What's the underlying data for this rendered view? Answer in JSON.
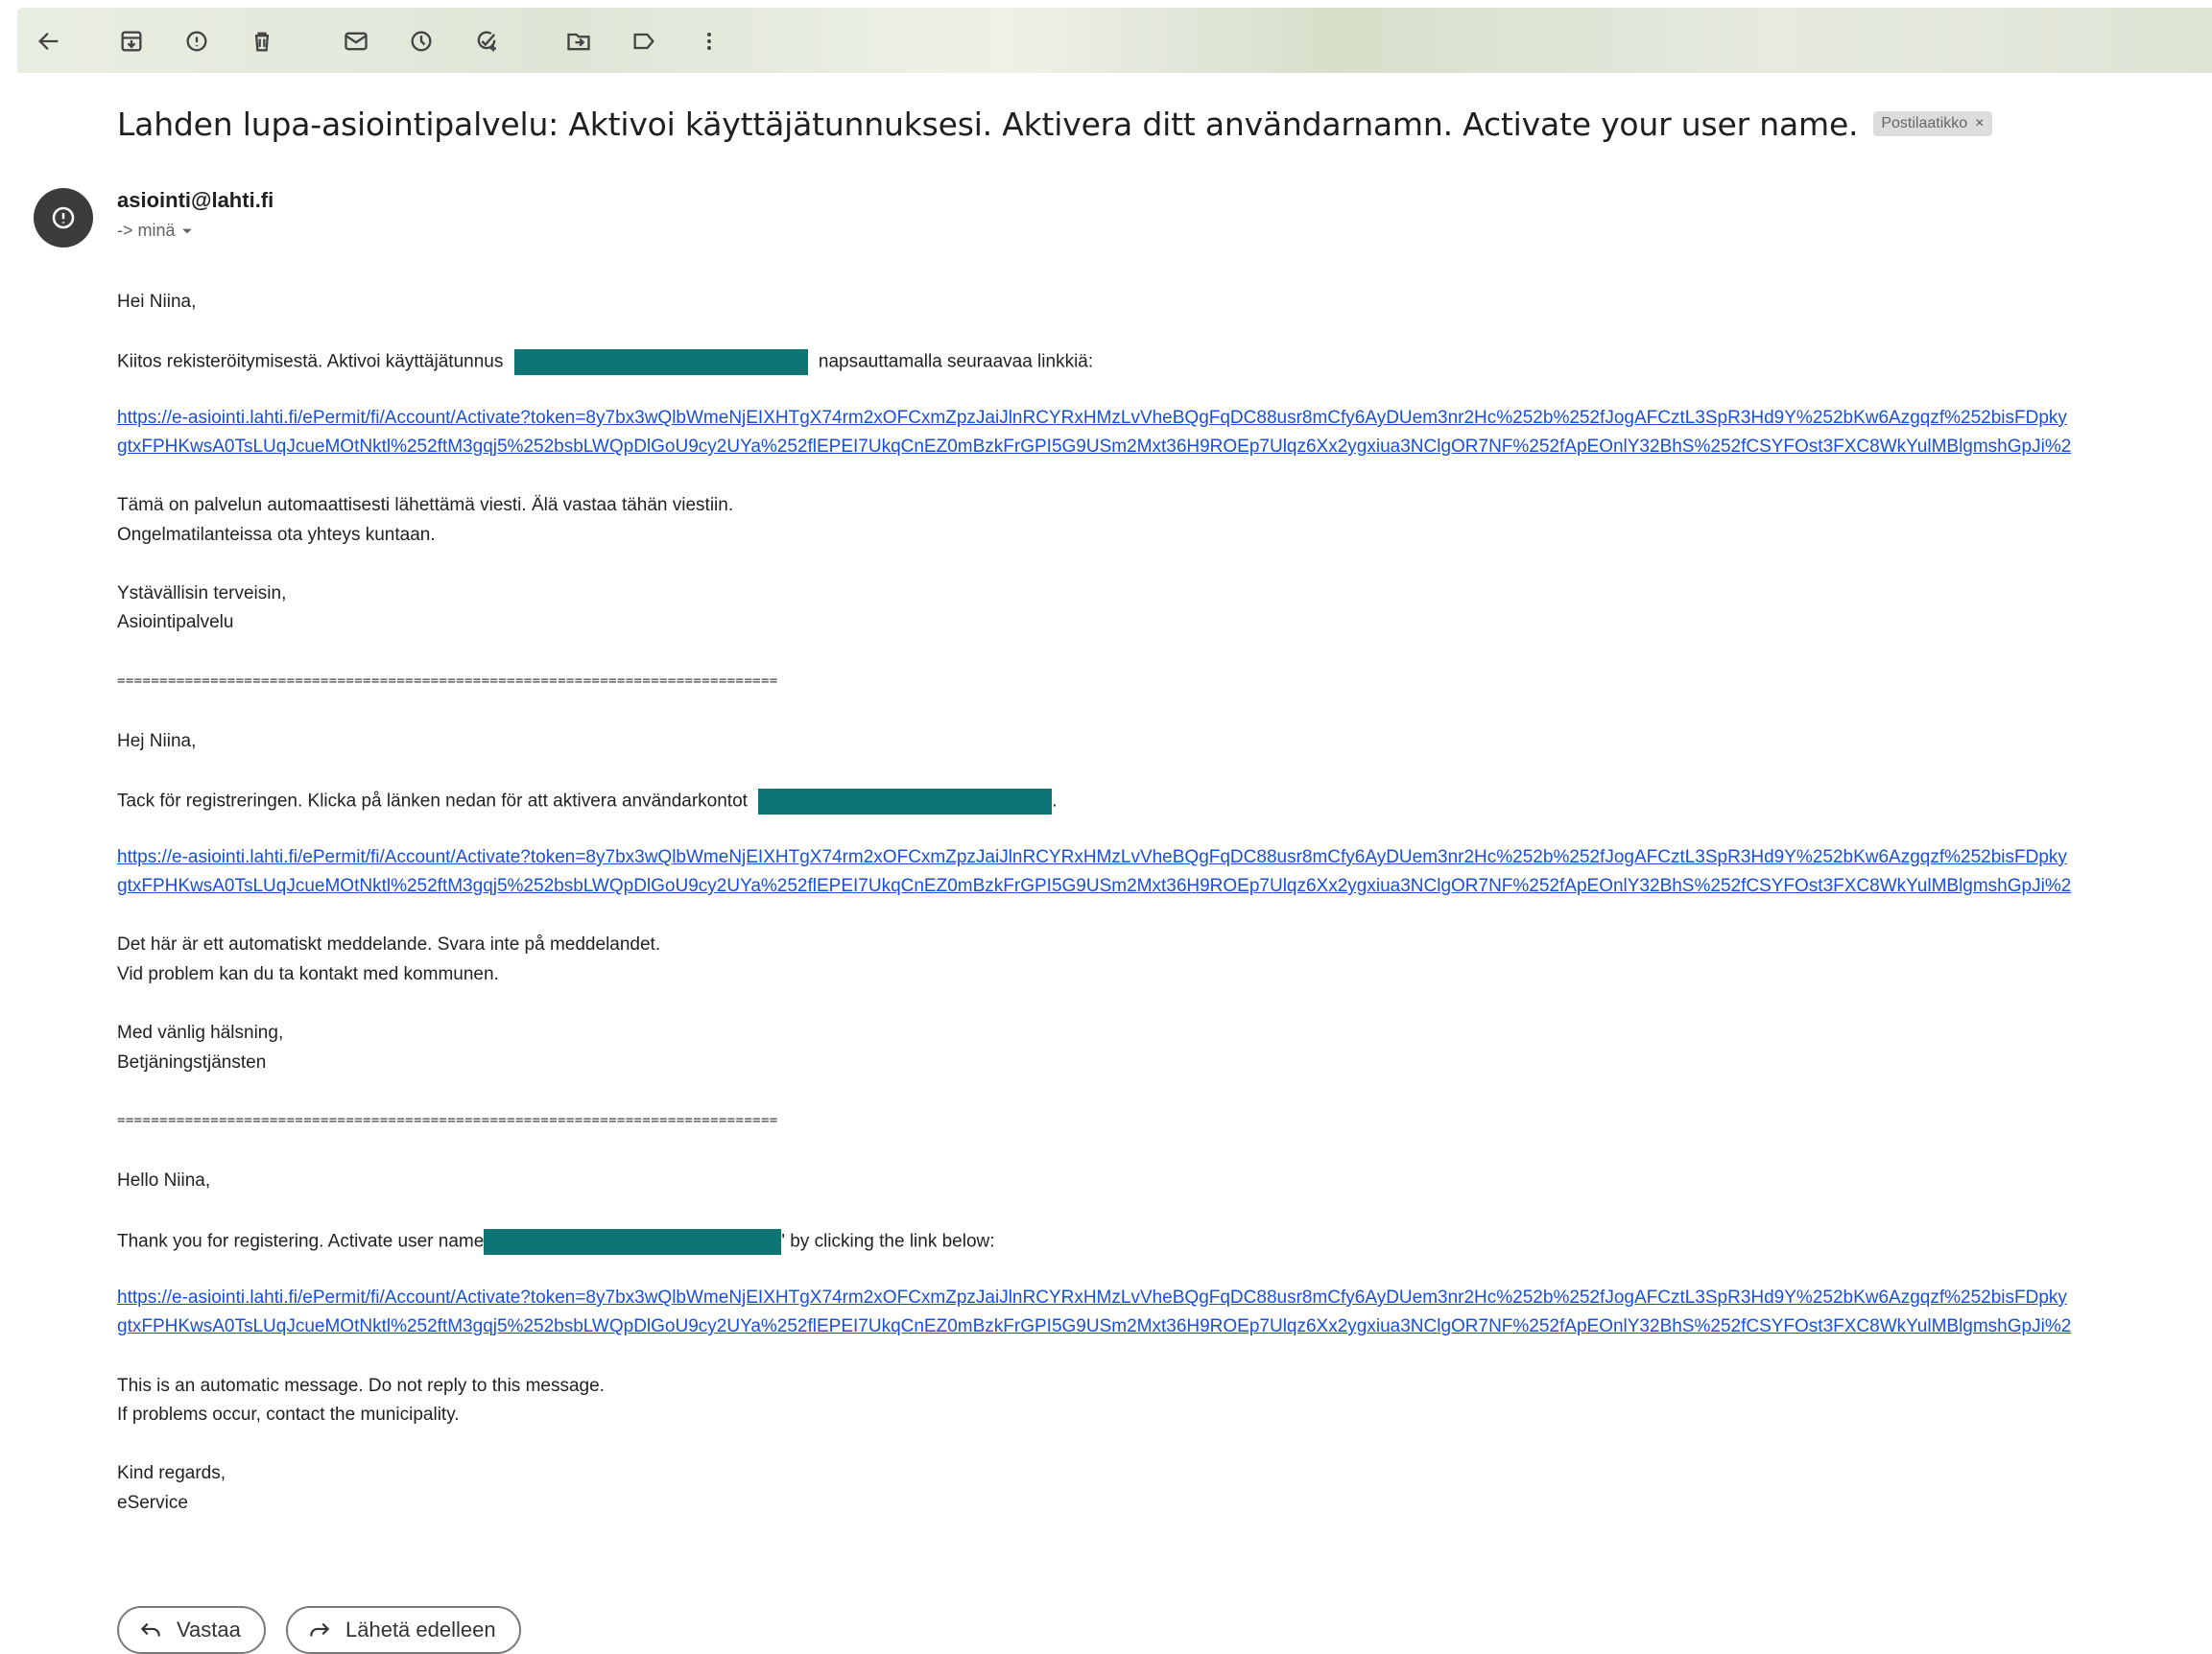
{
  "toolbar": {
    "icons": [
      "back-arrow-icon",
      "archive-icon",
      "report-spam-icon",
      "delete-icon",
      "mark-unread-icon",
      "snooze-icon",
      "add-task-icon",
      "move-to-icon",
      "label-icon",
      "more-icon"
    ]
  },
  "email": {
    "subject": "Lahden lupa-asiointipalvelu: Aktivoi käyttäjätunnuksesi. Aktivera ditt användarnamn. Activate your user name.",
    "label": "Postilaatikko",
    "label_remove": "×",
    "sender": "asiointi@lahti.fi",
    "recipient": "-> minä"
  },
  "body": {
    "fi": {
      "greeting": "Hei Niina,",
      "thanks_pre": "Kiitos rekisteröitymisestä. Aktivoi käyttäjätunnus",
      "thanks_post": "napsauttamalla seuraavaa linkkiä:",
      "link1": "https://e-asiointi.lahti.fi/ePermit/fi/Account/Activate?token=8y7bx3wQlbWmeNjEIXHTgX74rm2xOFCxmZpzJaiJlnRCYRxHMzLvVheBQgFqDC88usr8mCfy6AyDUem3nr2Hc%252b%252fJogAFCztL3SpR3Hd9Y%252bKw6Azgqzf%252bisFDpky",
      "link2": "gtxFPHKwsA0TsLUqJcueMOtNktl%252ftM3gqj5%252bsbLWQpDlGoU9cy2UYa%252flEPEI7UkqCnEZ0mBzkFrGPI5G9USm2Mxt36H9ROEp7Ulqz6Xx2ygxiua3NClgOR7NF%252fApEOnlY32BhS%252fCSYFOst3FXC8WkYulMBlgmshGpJi%2",
      "auto1": "Tämä on palvelun automaattisesti lähettämä viesti. Älä vastaa tähän viestiin.",
      "auto2": "Ongelmatilanteissa ota yhteys kuntaan.",
      "regards": "Ystävällisin terveisin,",
      "signature": "Asiointipalvelu"
    },
    "separator": "==============================================================================",
    "sv": {
      "greeting": "Hej Niina,",
      "thanks_pre": "Tack för registreringen. Klicka på länken nedan för att aktivera användarkontot",
      "thanks_post": ".",
      "link1": "https://e-asiointi.lahti.fi/ePermit/fi/Account/Activate?token=8y7bx3wQlbWmeNjEIXHTgX74rm2xOFCxmZpzJaiJlnRCYRxHMzLvVheBQgFqDC88usr8mCfy6AyDUem3nr2Hc%252b%252fJogAFCztL3SpR3Hd9Y%252bKw6Azgqzf%252bisFDpky",
      "link2": "gtxFPHKwsA0TsLUqJcueMOtNktl%252ftM3gqj5%252bsbLWQpDlGoU9cy2UYa%252flEPEI7UkqCnEZ0mBzkFrGPI5G9USm2Mxt36H9ROEp7Ulqz6Xx2ygxiua3NClgOR7NF%252fApEOnlY32BhS%252fCSYFOst3FXC8WkYulMBlgmshGpJi%2",
      "auto1": "Det här är ett automatiskt meddelande. Svara inte på meddelandet.",
      "auto2": "Vid problem kan du ta kontakt med kommunen.",
      "regards": "Med vänlig hälsning,",
      "signature": "Betjäningstjänsten"
    },
    "en": {
      "greeting": "Hello Niina,",
      "thanks_pre": "Thank you for registering. Activate user name",
      "thanks_post": "' by clicking the link below:",
      "link1": "https://e-asiointi.lahti.fi/ePermit/fi/Account/Activate?token=8y7bx3wQlbWmeNjEIXHTgX74rm2xOFCxmZpzJaiJlnRCYRxHMzLvVheBQgFqDC88usr8mCfy6AyDUem3nr2Hc%252b%252fJogAFCztL3SpR3Hd9Y%252bKw6Azgqzf%252bisFDpky",
      "link2": "gtxFPHKwsA0TsLUqJcueMOtNktl%252ftM3gqj5%252bsbLWQpDlGoU9cy2UYa%252flEPEI7UkqCnEZ0mBzkFrGPI5G9USm2Mxt36H9ROEp7Ulqz6Xx2ygxiua3NClgOR7NF%252fApEOnlY32BhS%252fCSYFOst3FXC8WkYulMBlgmshGpJi%2",
      "auto1": "This is an automatic message. Do not reply to this message.",
      "auto2": "If problems occur, contact the municipality.",
      "regards": "Kind regards,",
      "signature": "eService"
    }
  },
  "actions": {
    "reply": "Vastaa",
    "forward": "Lähetä edelleen"
  },
  "colors": {
    "redaction": "#0d7674",
    "link": "#1a4fd8"
  }
}
